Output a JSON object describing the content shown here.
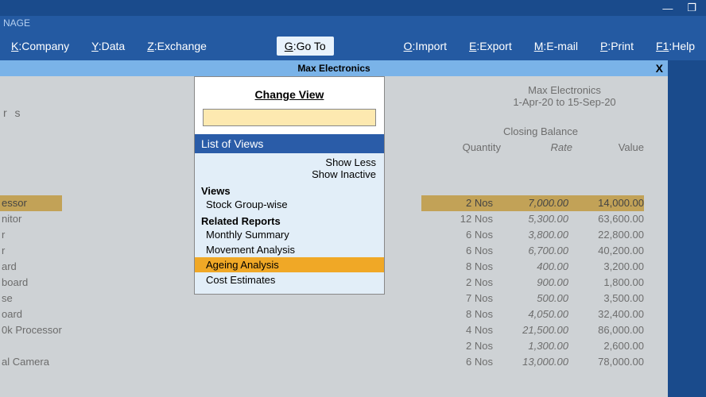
{
  "window": {
    "minimize": "—",
    "maximize": "❐"
  },
  "top_bar": "NAGE",
  "menu": {
    "company": {
      "key": "K",
      "label": "Company"
    },
    "data": {
      "key": "Y",
      "label": "Data"
    },
    "exchange": {
      "key": "Z",
      "label": "Exchange"
    },
    "goto": {
      "key": "G",
      "label": "Go To"
    },
    "import": {
      "key": "O",
      "label": "Import"
    },
    "export": {
      "key": "E",
      "label": "Export"
    },
    "email": {
      "key": "M",
      "label": "E-mail"
    },
    "print": {
      "key": "P",
      "label": "Print"
    },
    "help": {
      "key": "F1",
      "label": "Help"
    }
  },
  "company_name": "Max Electronics",
  "close_x": "X",
  "report": {
    "left_header": "r s",
    "right_header_company": "Max Electronics",
    "right_header_period": "1-Apr-20 to 15-Sep-20",
    "closing_balance": "Closing Balance",
    "col_qty": "Quantity",
    "col_rate": "Rate",
    "col_value": "Value",
    "items": [
      {
        "name": "essor",
        "qty": "2 Nos",
        "rate": "7,000.00",
        "value": "14,000.00"
      },
      {
        "name": "nitor",
        "qty": "12 Nos",
        "rate": "5,300.00",
        "value": "63,600.00"
      },
      {
        "name": "r",
        "qty": "6 Nos",
        "rate": "3,800.00",
        "value": "22,800.00"
      },
      {
        "name": "r",
        "qty": "6 Nos",
        "rate": "6,700.00",
        "value": "40,200.00"
      },
      {
        "name": "ard",
        "qty": "8 Nos",
        "rate": "400.00",
        "value": "3,200.00"
      },
      {
        "name": "board",
        "qty": "2 Nos",
        "rate": "900.00",
        "value": "1,800.00"
      },
      {
        "name": "se",
        "qty": "7 Nos",
        "rate": "500.00",
        "value": "3,500.00"
      },
      {
        "name": "oard",
        "qty": "8 Nos",
        "rate": "4,050.00",
        "value": "32,400.00"
      },
      {
        "name": "0k Processor",
        "qty": "4 Nos",
        "rate": "21,500.00",
        "value": "86,000.00"
      },
      {
        "name": "",
        "qty": "2 Nos",
        "rate": "1,300.00",
        "value": "2,600.00"
      },
      {
        "name": "al Camera",
        "qty": "6 Nos",
        "rate": "13,000.00",
        "value": "78,000.00"
      }
    ]
  },
  "popup": {
    "title": "Change View",
    "input_value": "",
    "list_header": "List of Views",
    "show_less": "Show Less",
    "show_inactive": "Show Inactive",
    "section_views": "Views",
    "view_items": [
      "Stock Group-wise"
    ],
    "section_related": "Related Reports",
    "related_items": [
      "Monthly Summary",
      "Movement Analysis",
      "Ageing Analysis",
      "Cost Estimates"
    ],
    "selected": "Ageing Analysis"
  }
}
